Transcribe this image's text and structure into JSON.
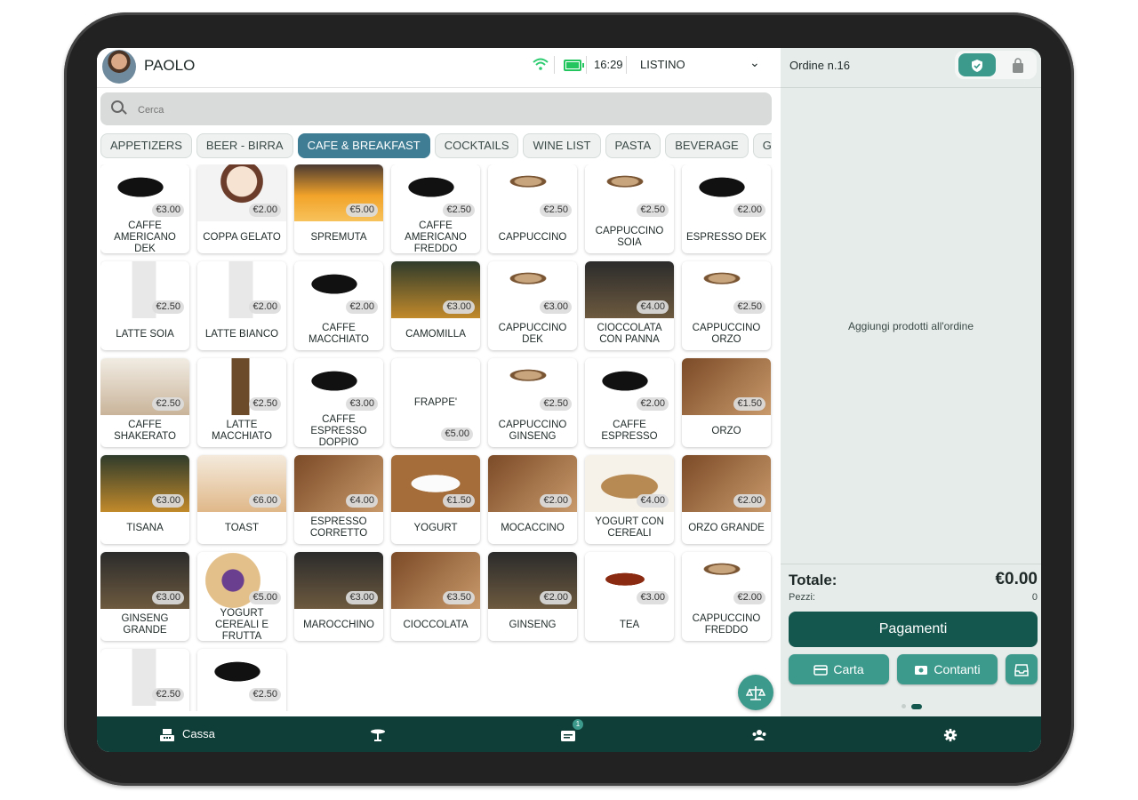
{
  "header": {
    "user_name": "PAOLO",
    "time": "16:29",
    "price_list": "LISTINO"
  },
  "search": {
    "placeholder": "Cerca"
  },
  "categories": [
    {
      "label": "APPETIZERS",
      "active": false
    },
    {
      "label": "BEER - BIRRA",
      "active": false
    },
    {
      "label": "CAFE & BREAKFAST",
      "active": true
    },
    {
      "label": "COCKTAILS",
      "active": false
    },
    {
      "label": "WINE LIST",
      "active": false
    },
    {
      "label": "PASTA",
      "active": false
    },
    {
      "label": "BEVERAGE",
      "active": false
    },
    {
      "label": "GRILL ME",
      "active": false
    }
  ],
  "products": [
    {
      "name": "CAFFE AMERICANO DEK",
      "price": "€3.00",
      "img": "cup-black"
    },
    {
      "name": "COPPA GELATO",
      "price": "€2.00",
      "img": "photo-gelato"
    },
    {
      "name": "SPREMUTA",
      "price": "€5.00",
      "img": "photo-orange"
    },
    {
      "name": "CAFFE AMERICANO FREDDO",
      "price": "€2.50",
      "img": "cup-black"
    },
    {
      "name": "CAPPUCCINO",
      "price": "€2.50",
      "img": "cup-cap"
    },
    {
      "name": "CAPPUCCINO SOIA",
      "price": "€2.50",
      "img": "cup-cap"
    },
    {
      "name": "ESPRESSO DEK",
      "price": "€2.00",
      "img": "cup-black"
    },
    {
      "name": "LATTE SOIA",
      "price": "€2.50",
      "img": "glass-milk"
    },
    {
      "name": "LATTE BIANCO",
      "price": "€2.00",
      "img": "glass-milk"
    },
    {
      "name": "CAFFE MACCHIATO",
      "price": "€2.00",
      "img": "cup-black"
    },
    {
      "name": "CAMOMILLA",
      "price": "€3.00",
      "img": "photo-tea"
    },
    {
      "name": "CAPPUCCINO DEK",
      "price": "€3.00",
      "img": "cup-cap"
    },
    {
      "name": "CIOCCOLATA CON PANNA",
      "price": "€4.00",
      "img": "photo-dark"
    },
    {
      "name": "CAPPUCCINO ORZO",
      "price": "€2.50",
      "img": "cup-cap"
    },
    {
      "name": "CAFFE SHAKERATO",
      "price": "€2.50",
      "img": "photo-light"
    },
    {
      "name": "LATTE MACCHIATO",
      "price": "€2.50",
      "img": "glass-latte"
    },
    {
      "name": "CAFFE ESPRESSO DOPPIO",
      "price": "€3.00",
      "img": "cup-black"
    },
    {
      "name": "FRAPPE'",
      "price": "€5.00",
      "img": ""
    },
    {
      "name": "CAPPUCCINO GINSENG",
      "price": "€2.50",
      "img": "cup-cap"
    },
    {
      "name": "CAFFE ESPRESSO",
      "price": "€2.00",
      "img": "cup-black"
    },
    {
      "name": "ORZO",
      "price": "€1.50",
      "img": "photo-brown"
    },
    {
      "name": "TISANA",
      "price": "€3.00",
      "img": "photo-tea"
    },
    {
      "name": "TOAST",
      "price": "€6.00",
      "img": "photo-toast"
    },
    {
      "name": "ESPRESSO CORRETTO",
      "price": "€4.00",
      "img": "photo-brown"
    },
    {
      "name": "YOGURT",
      "price": "€1.50",
      "img": "photo-yogurt"
    },
    {
      "name": "MOCACCINO",
      "price": "€2.00",
      "img": "photo-brown"
    },
    {
      "name": "YOGURT CON CEREALI",
      "price": "€4.00",
      "img": "photo-bowl"
    },
    {
      "name": "ORZO GRANDE",
      "price": "€2.00",
      "img": "photo-brown"
    },
    {
      "name": "GINSENG GRANDE",
      "price": "€3.00",
      "img": "photo-dark"
    },
    {
      "name": "YOGURT CEREALI E FRUTTA",
      "price": "€5.00",
      "img": "photo-berries"
    },
    {
      "name": "MAROCCHINO",
      "price": "€3.00",
      "img": "photo-dark"
    },
    {
      "name": "CIOCCOLATA",
      "price": "€3.50",
      "img": "photo-brown"
    },
    {
      "name": "GINSENG",
      "price": "€2.00",
      "img": "photo-dark"
    },
    {
      "name": "TEA",
      "price": "€3.00",
      "img": "photo-tea-clear"
    },
    {
      "name": "CAPPUCCINO FREDDO",
      "price": "€2.00",
      "img": "cup-cap"
    },
    {
      "name": "",
      "price": "€2.50",
      "img": "glass-milk"
    },
    {
      "name": "",
      "price": "€2.50",
      "img": "cup-black"
    }
  ],
  "order": {
    "title": "Ordine n.16",
    "empty_message": "Aggiungi prodotti all'ordine",
    "total_label": "Totale:",
    "total_value": "€0.00",
    "pieces_label": "Pezzi:",
    "pieces_value": "0",
    "pay_button": "Pagamenti",
    "card_button": "Carta",
    "cash_button": "Contanti"
  },
  "nav": {
    "cassa": "Cassa",
    "orders_badge": "1"
  },
  "colors": {
    "accent": "#3c9a8c",
    "dark": "#0f3d37",
    "category_active": "#3e7d94"
  }
}
